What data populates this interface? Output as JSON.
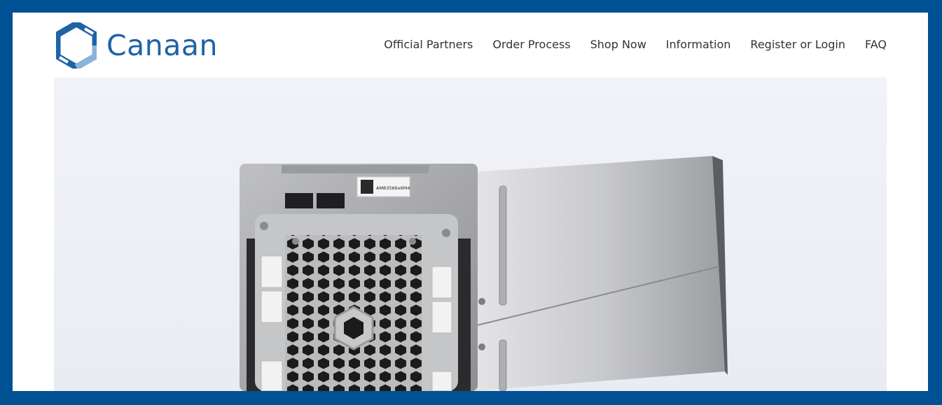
{
  "brand": {
    "name": "Canaan",
    "logo_icon": "hexagon-logo-icon",
    "color": "#1e63a6",
    "frame_color": "#005193"
  },
  "nav": {
    "items": [
      {
        "label": "Official Partners"
      },
      {
        "label": "Order Process"
      },
      {
        "label": "Shop Now"
      },
      {
        "label": "Information"
      },
      {
        "label": "Register or Login"
      },
      {
        "label": "FAQ"
      }
    ]
  },
  "hero": {
    "device_label": "AM83566x6M4"
  }
}
